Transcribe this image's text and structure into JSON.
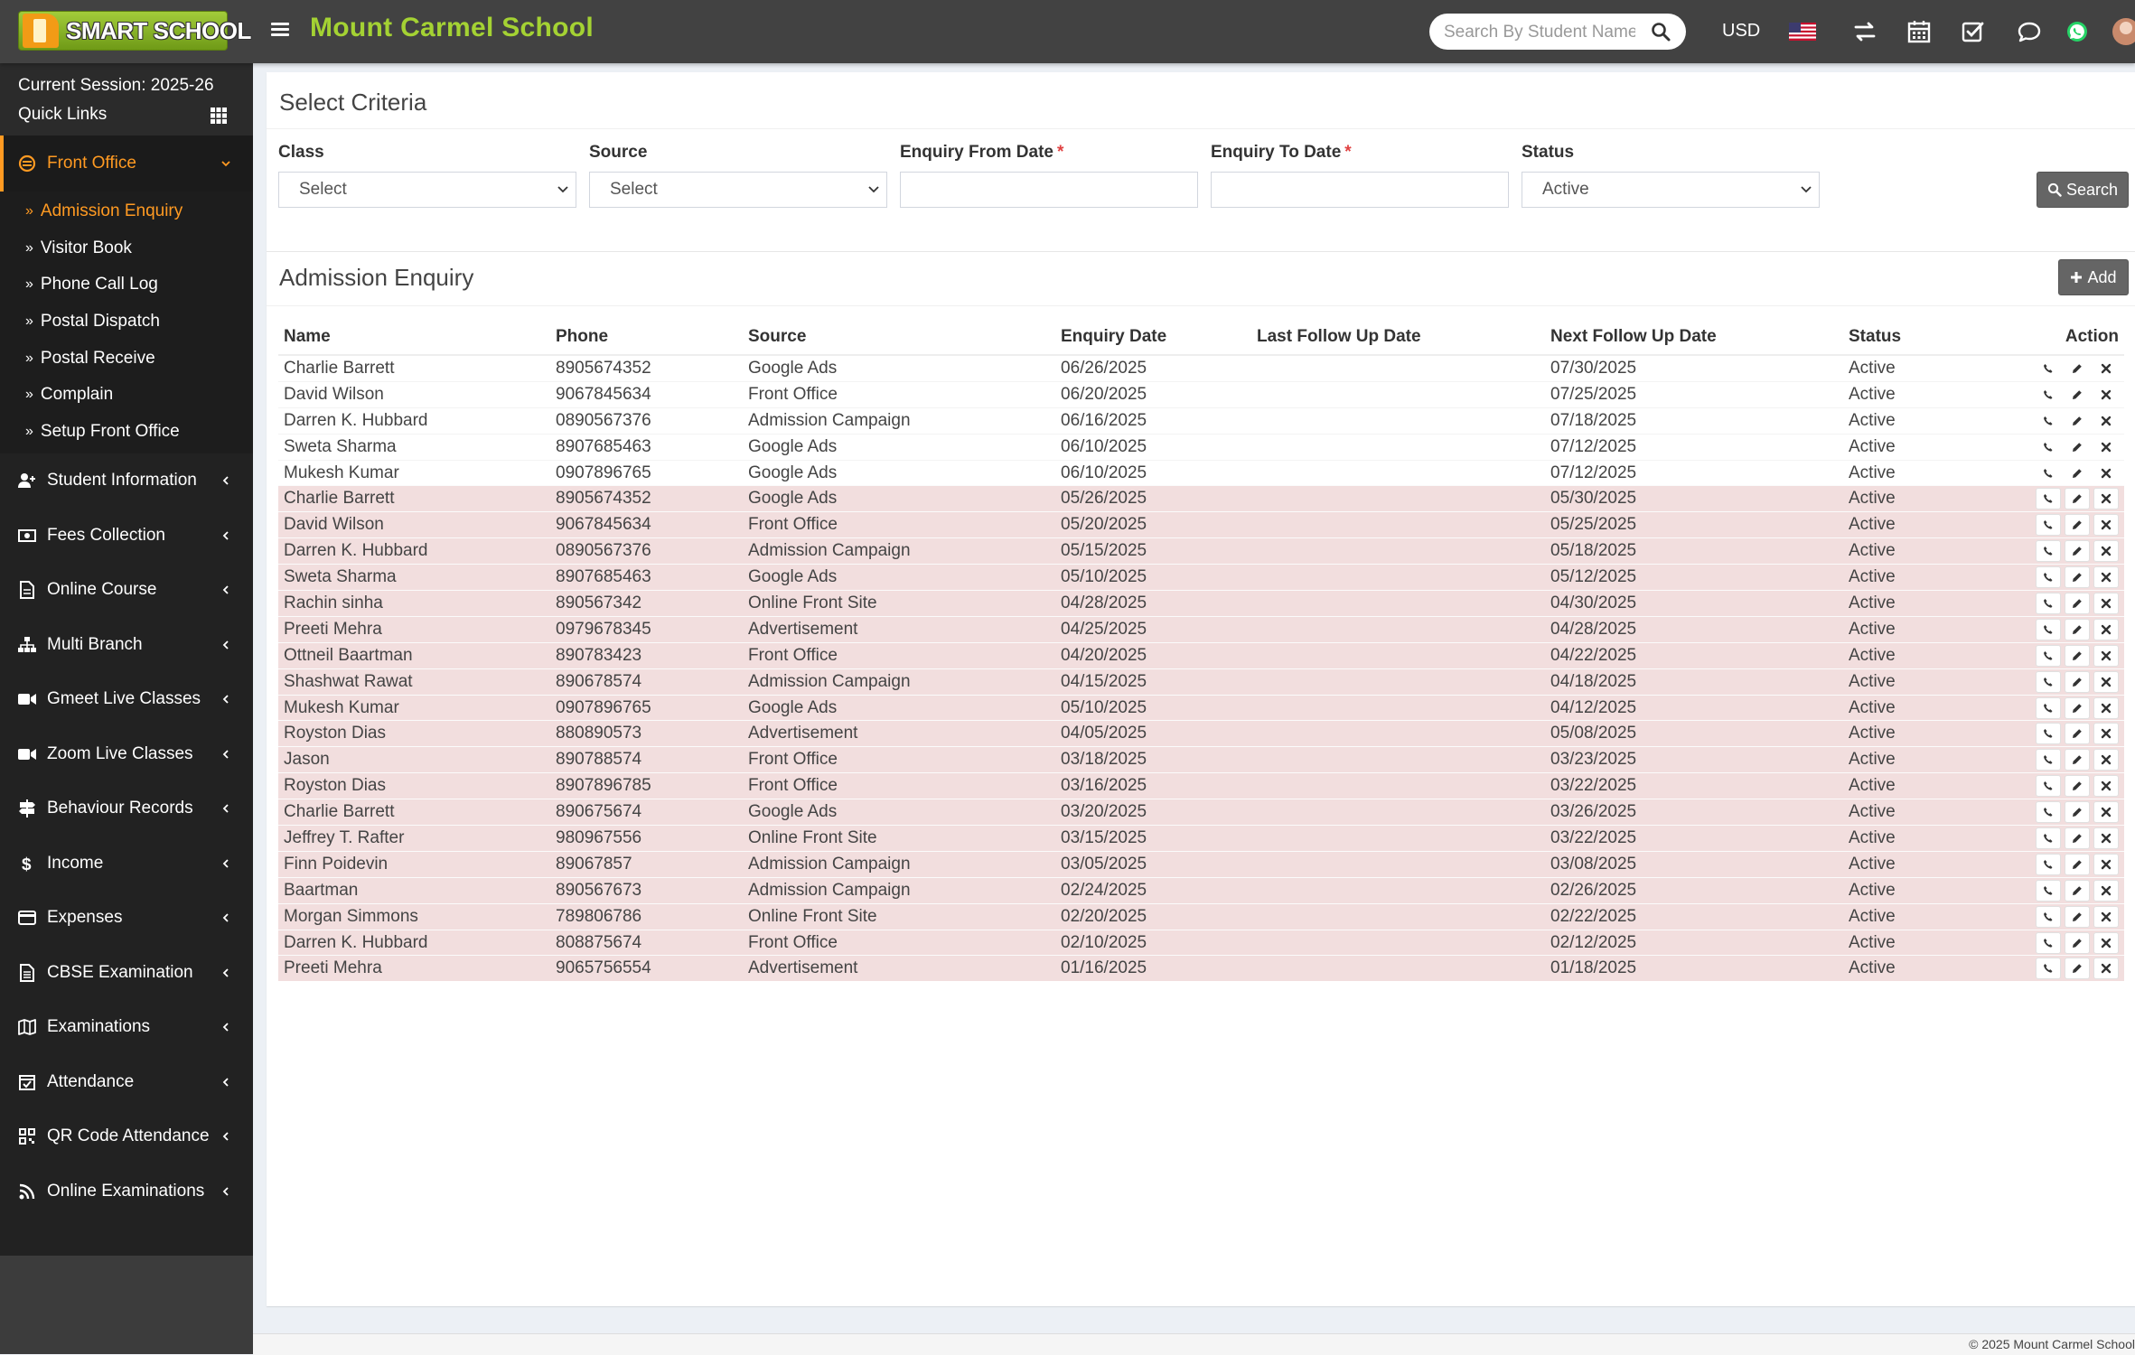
{
  "brand": {
    "logo_text": "SMART SCHOOL",
    "school_name": "Mount Carmel School"
  },
  "topbar": {
    "search_placeholder": "Search By Student Name",
    "currency": "USD",
    "icons": [
      "menu-icon",
      "search-icon",
      "us-flag-icon",
      "switch-icon",
      "calendar-icon",
      "tasks-icon",
      "chat-icon",
      "whatsapp-icon",
      "avatar"
    ]
  },
  "sidebar": {
    "session": "Current Session: 2025-26",
    "quick_links": "Quick Links",
    "active_menu": "Front Office",
    "submenu": [
      "Admission Enquiry",
      "Visitor Book",
      "Phone Call Log",
      "Postal Dispatch",
      "Postal Receive",
      "Complain",
      "Setup Front Office"
    ],
    "items": [
      "Student Information",
      "Fees Collection",
      "Online Course",
      "Multi Branch",
      "Gmeet Live Classes",
      "Zoom Live Classes",
      "Behaviour Records",
      "Income",
      "Expenses",
      "CBSE Examination",
      "Examinations",
      "Attendance",
      "QR Code Attendance",
      "Online Examinations"
    ]
  },
  "criteria": {
    "title": "Select Criteria",
    "class_label": "Class",
    "class_value": "Select",
    "source_label": "Source",
    "source_value": "Select",
    "from_label": "Enquiry From Date",
    "to_label": "Enquiry To Date",
    "required_mark": "*",
    "status_label": "Status",
    "status_value": "Active",
    "search_button": "Search"
  },
  "enquiry": {
    "title": "Admission Enquiry",
    "add_button": "Add",
    "columns": [
      "Name",
      "Phone",
      "Source",
      "Enquiry Date",
      "Last Follow Up Date",
      "Next Follow Up Date",
      "Status",
      "Action"
    ],
    "rows": [
      [
        "Charlie Barrett",
        "8905674352",
        "Google Ads",
        "06/26/2025",
        "",
        "07/30/2025",
        "Active"
      ],
      [
        "David Wilson",
        "9067845634",
        "Front Office",
        "06/20/2025",
        "",
        "07/25/2025",
        "Active"
      ],
      [
        "Darren K. Hubbard",
        "0890567376",
        "Admission Campaign",
        "06/16/2025",
        "",
        "07/18/2025",
        "Active"
      ],
      [
        "Sweta Sharma",
        "8907685463",
        "Google Ads",
        "06/10/2025",
        "",
        "07/12/2025",
        "Active"
      ],
      [
        "Mukesh Kumar",
        "0907896765",
        "Google Ads",
        "06/10/2025",
        "",
        "07/12/2025",
        "Active"
      ],
      [
        "Charlie Barrett",
        "8905674352",
        "Google Ads",
        "05/26/2025",
        "",
        "05/30/2025",
        "Active"
      ],
      [
        "David Wilson",
        "9067845634",
        "Front Office",
        "05/20/2025",
        "",
        "05/25/2025",
        "Active"
      ],
      [
        "Darren K. Hubbard",
        "0890567376",
        "Admission Campaign",
        "05/15/2025",
        "",
        "05/18/2025",
        "Active"
      ],
      [
        "Sweta Sharma",
        "8907685463",
        "Google Ads",
        "05/10/2025",
        "",
        "05/12/2025",
        "Active"
      ],
      [
        "Rachin sinha",
        "890567342",
        "Online Front Site",
        "04/28/2025",
        "",
        "04/30/2025",
        "Active"
      ],
      [
        "Preeti Mehra",
        "0979678345",
        "Advertisement",
        "04/25/2025",
        "",
        "04/28/2025",
        "Active"
      ],
      [
        "Ottneil Baartman",
        "890783423",
        "Front Office",
        "04/20/2025",
        "",
        "04/22/2025",
        "Active"
      ],
      [
        "Shashwat Rawat",
        "890678574",
        "Admission Campaign",
        "04/15/2025",
        "",
        "04/18/2025",
        "Active"
      ],
      [
        "Mukesh Kumar",
        "0907896765",
        "Google Ads",
        "05/10/2025",
        "",
        "04/12/2025",
        "Active"
      ],
      [
        "Royston Dias",
        "880890573",
        "Advertisement",
        "04/05/2025",
        "",
        "05/08/2025",
        "Active"
      ],
      [
        "Jason",
        "890788574",
        "Front Office",
        "03/18/2025",
        "",
        "03/23/2025",
        "Active"
      ],
      [
        "Royston Dias",
        "8907896785",
        "Front Office",
        "03/16/2025",
        "",
        "03/22/2025",
        "Active"
      ],
      [
        "Charlie Barrett",
        "890675674",
        "Google Ads",
        "03/20/2025",
        "",
        "03/26/2025",
        "Active"
      ],
      [
        "Jeffrey T. Rafter",
        "980967556",
        "Online Front Site",
        "03/15/2025",
        "",
        "03/22/2025",
        "Active"
      ],
      [
        "Finn Poidevin",
        "89067857",
        "Admission Campaign",
        "03/05/2025",
        "",
        "03/08/2025",
        "Active"
      ],
      [
        "Baartman",
        "890567673",
        "Admission Campaign",
        "02/24/2025",
        "",
        "02/26/2025",
        "Active"
      ],
      [
        "Morgan Simmons",
        "789806786",
        "Online Front Site",
        "02/20/2025",
        "",
        "02/22/2025",
        "Active"
      ],
      [
        "Darren K. Hubbard",
        "808875674",
        "Front Office",
        "02/10/2025",
        "",
        "02/12/2025",
        "Active"
      ],
      [
        "Preeti Mehra",
        "9065756554",
        "Advertisement",
        "01/16/2025",
        "",
        "01/18/2025",
        "Active"
      ]
    ],
    "highlight_from_row": 5,
    "highlight_color": "#f2dede"
  },
  "footer": {
    "copyright": "© 2025 Mount Carmel School"
  },
  "colors": {
    "accent": "#ff9a22",
    "brand_green": "#a4d233",
    "topbar": "#424242",
    "sidebar": "#222222"
  }
}
